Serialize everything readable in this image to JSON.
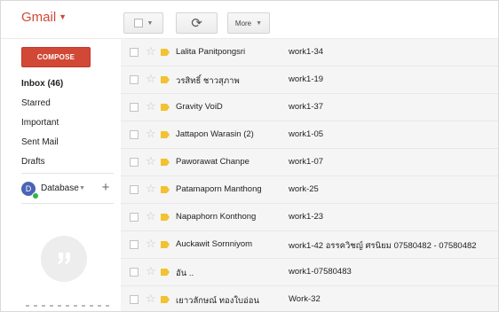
{
  "header": {
    "logo": "Gmail",
    "more_label": "More"
  },
  "sidebar": {
    "compose_label": "COMPOSE",
    "items": [
      {
        "label": "Inbox (46)",
        "bold": true
      },
      {
        "label": "Starred",
        "bold": false
      },
      {
        "label": "Important",
        "bold": false
      },
      {
        "label": "Sent Mail",
        "bold": false
      },
      {
        "label": "Drafts",
        "bold": false
      }
    ],
    "account": {
      "initial": "D",
      "name": "Database"
    }
  },
  "messages": [
    {
      "sender": "Lalita Panitpongsri",
      "subject": "work1-34"
    },
    {
      "sender": "วรสิทธิ์ ชาวสุภาพ",
      "subject": "work1-19"
    },
    {
      "sender": "Gravity VoiD",
      "subject": "work1-37"
    },
    {
      "sender": "Jattapon Warasin (2)",
      "subject": "work1-05"
    },
    {
      "sender": "Paworawat Chanpe",
      "subject": "work1-07"
    },
    {
      "sender": "Patamaporn Manthong",
      "subject": "work-25"
    },
    {
      "sender": "Napaphorn Konthong",
      "subject": "work1-23"
    },
    {
      "sender": "Auckawit Sornniyom",
      "subject": "work1-42 อรรควิชญ์ ศรนิยม 07580482 - 07580482"
    },
    {
      "sender": "อัน ..",
      "subject": "work1-07580483"
    },
    {
      "sender": "เยาวลักษณ์ ทองใบอ่อน",
      "subject": "Work-32"
    }
  ],
  "colors": {
    "brand_red": "#d14836",
    "importance_marker": "#f2c230",
    "avatar_blue": "#4a63b5",
    "online_green": "#2fb34a"
  },
  "icons": [
    "caret-down-icon",
    "checkbox-icon",
    "refresh-icon",
    "star-icon",
    "importance-marker-icon",
    "plus-icon",
    "hangouts-icon"
  ]
}
